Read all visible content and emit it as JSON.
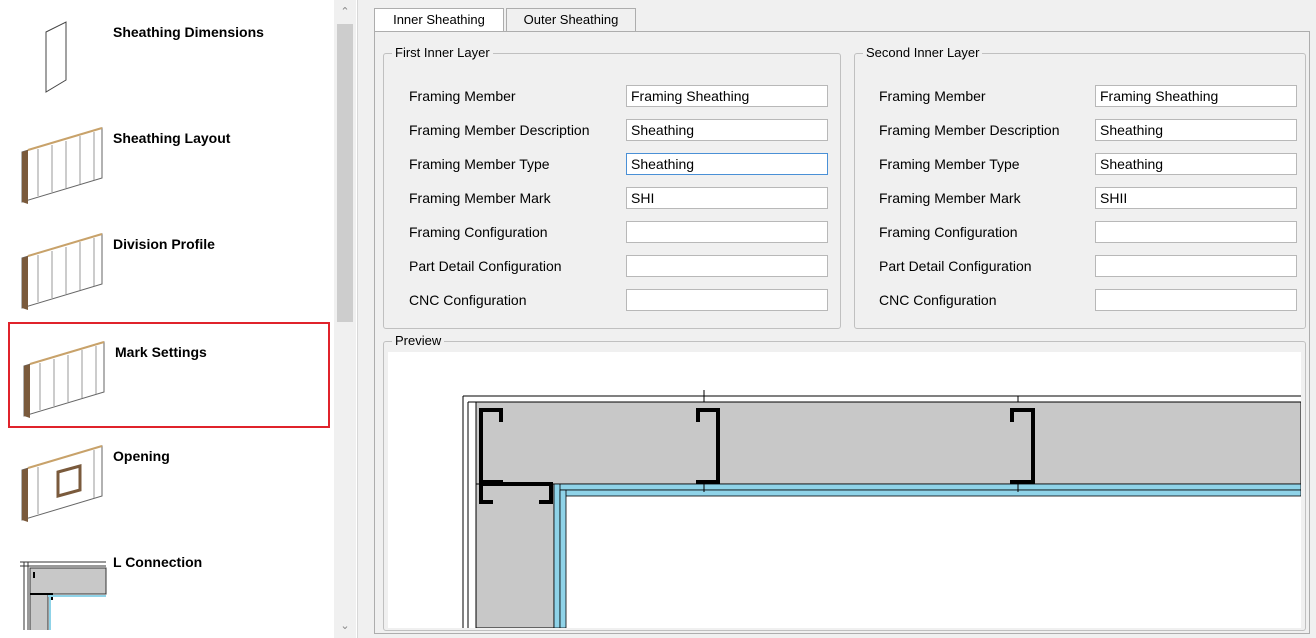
{
  "sidebar": {
    "items": [
      {
        "label": "Sheathing Dimensions",
        "icon": "sheathing-dimensions-icon",
        "selected": false
      },
      {
        "label": "Sheathing Layout",
        "icon": "wall-panel-icon",
        "selected": false
      },
      {
        "label": "Division Profile",
        "icon": "wall-panel-icon",
        "selected": false
      },
      {
        "label": "Mark Settings",
        "icon": "wall-panel-icon",
        "selected": true
      },
      {
        "label": "Opening",
        "icon": "wall-opening-icon",
        "selected": false
      },
      {
        "label": "L Connection",
        "icon": "l-connection-icon",
        "selected": false
      }
    ],
    "selection_color": "#e0232b"
  },
  "tabs": [
    {
      "label": "Inner Sheathing",
      "active": true
    },
    {
      "label": "Outer Sheathing",
      "active": false
    }
  ],
  "first_layer": {
    "title": "First Inner Layer",
    "fields": [
      {
        "label": "Framing Member",
        "value": "Framing Sheathing"
      },
      {
        "label": "Framing Member Description",
        "value": "Sheathing"
      },
      {
        "label": "Framing Member Type",
        "value": "Sheathing"
      },
      {
        "label": "Framing Member Mark",
        "value": "SHI"
      },
      {
        "label": "Framing Configuration",
        "value": ""
      },
      {
        "label": "Part Detail Configuration",
        "value": ""
      },
      {
        "label": "CNC Configuration",
        "value": ""
      }
    ]
  },
  "second_layer": {
    "title": "Second Inner Layer",
    "fields": [
      {
        "label": "Framing Member",
        "value": "Framing Sheathing"
      },
      {
        "label": "Framing Member Description",
        "value": "Sheathing"
      },
      {
        "label": "Framing Member Type",
        "value": "Sheathing"
      },
      {
        "label": "Framing Member Mark",
        "value": "SHII"
      },
      {
        "label": "Framing Configuration",
        "value": ""
      },
      {
        "label": "Part Detail Configuration",
        "value": ""
      },
      {
        "label": "CNC Configuration",
        "value": ""
      }
    ]
  },
  "preview": {
    "title": "Preview",
    "stud_fill": "#c8c8c8",
    "sheathing_color": "#8fd3e8"
  }
}
